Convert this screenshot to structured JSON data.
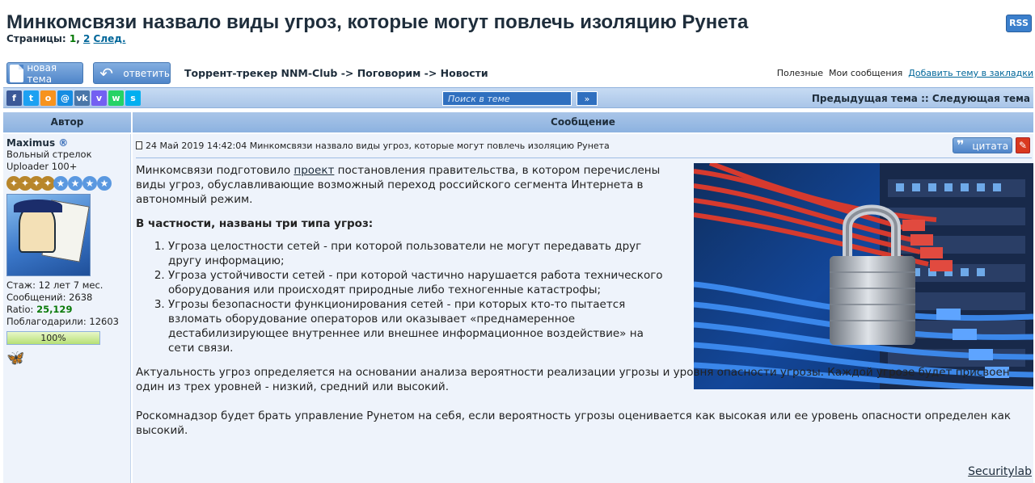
{
  "header": {
    "title": "Минкомсвязи назвало виды угроз, которые могут повлечь изоляцию Рунета",
    "pages_label": "Страницы:",
    "page_1": "1",
    "page_sep": ",",
    "page_2": "2",
    "next": "След.",
    "rss": "RSS"
  },
  "toolbar": {
    "new_topic": "новая тема",
    "reply": "ответить",
    "breadcrumb": "Торрент-трекер NNM-Club -> Поговорим -> Новости",
    "useful": "Полезные",
    "my_messages": "Мои сообщения",
    "bookmark": "Добавить тему в закладки"
  },
  "navbar": {
    "social": [
      {
        "icon": "facebook-icon",
        "glyph": "f",
        "color": "#3b5998"
      },
      {
        "icon": "twitter-icon",
        "glyph": "t",
        "color": "#1da1f2"
      },
      {
        "icon": "odnoklassniki-icon",
        "glyph": "o",
        "color": "#f7931e"
      },
      {
        "icon": "moimir-icon",
        "glyph": "@",
        "color": "#168de2"
      },
      {
        "icon": "vk-icon",
        "glyph": "vk",
        "color": "#4a76a8"
      },
      {
        "icon": "viber-icon",
        "glyph": "v",
        "color": "#7360f2"
      },
      {
        "icon": "whatsapp-icon",
        "glyph": "w",
        "color": "#25d366"
      },
      {
        "icon": "skype-icon",
        "glyph": "s",
        "color": "#00aff0"
      }
    ],
    "search_placeholder": "Поиск в теме",
    "search_go": "»",
    "prev_next": "Предыдущая тема :: Следующая тема"
  },
  "table": {
    "col_author": "Автор",
    "col_message": "Сообщение"
  },
  "author": {
    "name": "Maximus",
    "reg_mark": "®",
    "rank": "Вольный стрелок",
    "uploader": "Uploader 100+",
    "tenure": "Стаж: 12 лет 7 мес.",
    "posts": "Сообщений: 2638",
    "ratio_label": "Ratio:",
    "ratio_value": "25,129",
    "thanks": "Поблагодарили: 12603",
    "ratio_bar": "100%",
    "ratio_fill": 1.0
  },
  "post": {
    "meta": "24 Май 2019 14:42:04  Минкомсвязи назвало виды угроз, которые могут повлечь изоляцию Рунета",
    "quote_button": "цитата",
    "intro_before": "Минкомсвязи подготовило ",
    "intro_link": "проект",
    "intro_after": " постановления правительства, в котором перечислены виды угроз, обуславливающие возможный переход российского сегмента Интернета в автономный режим.",
    "heading": "В частности, названы три типа угроз:",
    "threats": [
      "Угроза целостности сетей - при которой пользователи не могут передавать друг другу информацию;",
      "Угроза устойчивости сетей - при которой частично нарушается работа технического оборудования или происходят природные либо техногенные катастрофы;",
      "Угрозы безопасности функционирования сетей - при которых кто-то пытается взломать оборудование операторов или оказывает «преднамеренное дестабилизирующее внутреннее или внешнее информационное воздействие» на сети связи."
    ],
    "paragraph_2": "Актуальность угроз определяется на основании анализа вероятности реализации угрозы и уровня опасности угрозы. Каждой угрозе будет присвоен один из трех уровней - низкий, средний или высокий.",
    "paragraph_3": "Роскомнадзор будет брать управление Рунетом на себя, если вероятность угрозы оценивается как высокая или ее уровень опасности определен как высокий.",
    "source": "Securitylab"
  }
}
